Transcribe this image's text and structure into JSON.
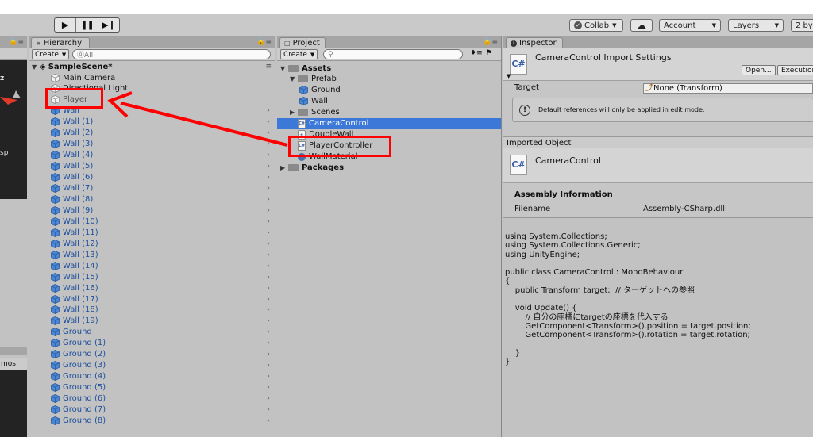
{
  "toolbar": {
    "play_icon": "play-icon",
    "pause_icon": "pause-icon",
    "step_icon": "step-icon",
    "collab_label": "Collab",
    "account_label": "Account",
    "layers_label": "Layers",
    "layout_label": "2 by"
  },
  "scene_view": {
    "gizmo_letter": "z",
    "persp_text": "sp",
    "gizmos_label": "mos"
  },
  "hierarchy": {
    "tab_label": "Hierarchy",
    "create_label": "Create",
    "search_placeholder": "ⓠAll",
    "scene_name": "SampleScene*",
    "items": [
      {
        "label": "Main Camera",
        "style": "normal"
      },
      {
        "label": "Directional Light",
        "style": "normal"
      },
      {
        "label": "Player",
        "style": "gray"
      },
      {
        "label": "Wall",
        "style": "prefab"
      },
      {
        "label": "Wall (1)",
        "style": "prefab"
      },
      {
        "label": "Wall (2)",
        "style": "prefab"
      },
      {
        "label": "Wall (3)",
        "style": "prefab"
      },
      {
        "label": "Wall (4)",
        "style": "prefab"
      },
      {
        "label": "Wall (5)",
        "style": "prefab"
      },
      {
        "label": "Wall (6)",
        "style": "prefab"
      },
      {
        "label": "Wall (7)",
        "style": "prefab"
      },
      {
        "label": "Wall (8)",
        "style": "prefab"
      },
      {
        "label": "Wall (9)",
        "style": "prefab"
      },
      {
        "label": "Wall (10)",
        "style": "prefab"
      },
      {
        "label": "Wall (11)",
        "style": "prefab"
      },
      {
        "label": "Wall (12)",
        "style": "prefab"
      },
      {
        "label": "Wall (13)",
        "style": "prefab"
      },
      {
        "label": "Wall (14)",
        "style": "prefab"
      },
      {
        "label": "Wall (15)",
        "style": "prefab"
      },
      {
        "label": "Wall (16)",
        "style": "prefab"
      },
      {
        "label": "Wall (17)",
        "style": "prefab"
      },
      {
        "label": "Wall (18)",
        "style": "prefab"
      },
      {
        "label": "Wall (19)",
        "style": "prefab"
      },
      {
        "label": "Ground",
        "style": "prefab"
      },
      {
        "label": "Ground (1)",
        "style": "prefab"
      },
      {
        "label": "Ground (2)",
        "style": "prefab"
      },
      {
        "label": "Ground (3)",
        "style": "prefab"
      },
      {
        "label": "Ground (4)",
        "style": "prefab"
      },
      {
        "label": "Ground (5)",
        "style": "prefab"
      },
      {
        "label": "Ground (6)",
        "style": "prefab"
      },
      {
        "label": "Ground (7)",
        "style": "prefab"
      },
      {
        "label": "Ground (8)",
        "style": "prefab"
      }
    ]
  },
  "project": {
    "tab_label": "Project",
    "create_label": "Create",
    "items": [
      {
        "label": "Assets",
        "kind": "folder",
        "level": 0,
        "bold": true,
        "open": true
      },
      {
        "label": "Prefab",
        "kind": "folder",
        "level": 1,
        "bold": false,
        "open": true
      },
      {
        "label": "Ground",
        "kind": "prefab",
        "level": 2
      },
      {
        "label": "Wall",
        "kind": "prefab",
        "level": 2
      },
      {
        "label": "Scenes",
        "kind": "folder",
        "level": 1,
        "bold": false,
        "open": false
      },
      {
        "label": "CameraControl",
        "kind": "script",
        "level": 1,
        "selected": true
      },
      {
        "label": "DoubleWall",
        "kind": "scene",
        "level": 1
      },
      {
        "label": "PlayerController",
        "kind": "script",
        "level": 1
      },
      {
        "label": "WallMaterial",
        "kind": "material",
        "level": 1
      },
      {
        "label": "Packages",
        "kind": "folder",
        "level": 0,
        "bold": true,
        "open": false
      }
    ]
  },
  "inspector": {
    "tab_label": "Inspector",
    "title": "CameraControl Import Settings",
    "open_label": "Open...",
    "execution_label": "Execution",
    "target_label": "Target",
    "target_value": "None (Transform)",
    "help_text": "Default references will only be applied in edit mode.",
    "imported_object_label": "Imported Object",
    "object_name": "CameraControl",
    "assembly_heading": "Assembly Information",
    "filename_label": "Filename",
    "filename_value": "Assembly-CSharp.dll",
    "code": "using System.Collections;\nusing System.Collections.Generic;\nusing UnityEngine;\n\npublic class CameraControl : MonoBehaviour\n{\n    public Transform target;  // ターゲットへの参照\n\n    void Update() {\n        // 自分の座標にtargetの座標を代入する\n        GetComponent<Transform>().position = target.position;\n        GetComponent<Transform>().rotation = target.rotation;\n\n    }\n}"
  },
  "colors": {
    "annotation": "#ff0000",
    "selection": "#3c78d8",
    "prefab_text": "#1c4f9e"
  }
}
